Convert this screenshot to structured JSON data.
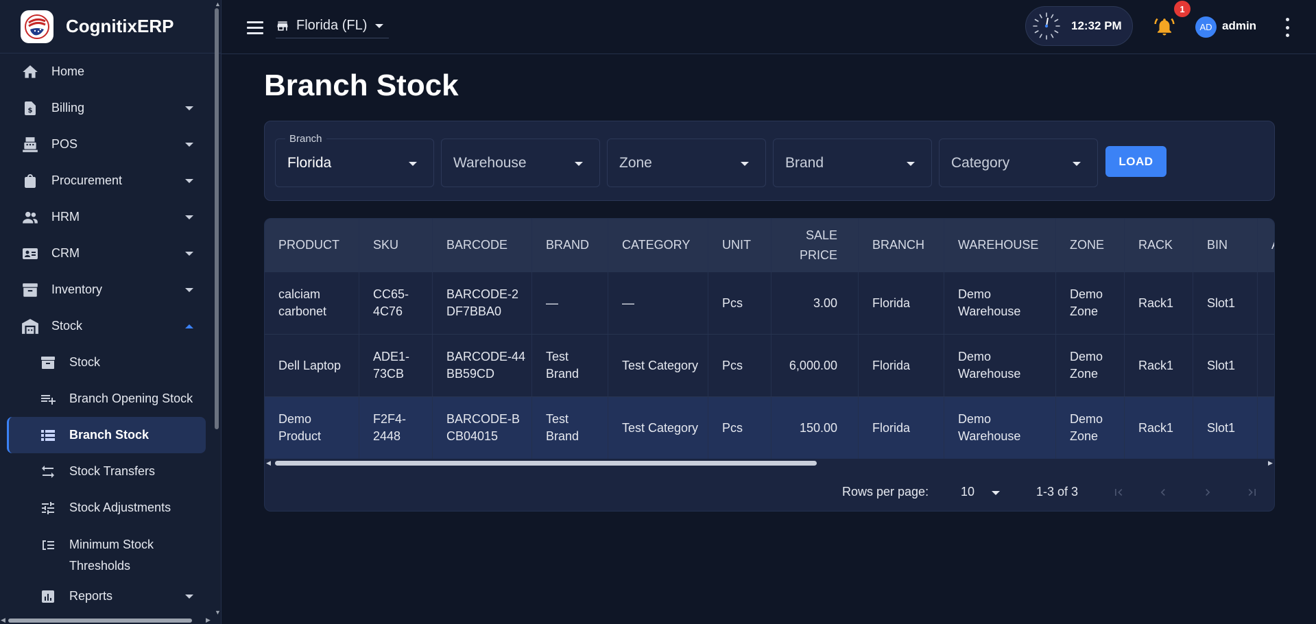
{
  "app": {
    "name": "CognitixERP"
  },
  "sidebar": {
    "items": [
      {
        "label": "Home",
        "icon": "home-icon"
      },
      {
        "label": "Billing",
        "icon": "billing-icon"
      },
      {
        "label": "POS",
        "icon": "pos-icon"
      },
      {
        "label": "Procurement",
        "icon": "bag-icon"
      },
      {
        "label": "HRM",
        "icon": "people-icon"
      },
      {
        "label": "CRM",
        "icon": "contact-card-icon"
      },
      {
        "label": "Inventory",
        "icon": "archive-icon"
      },
      {
        "label": "Stock",
        "icon": "warehouse-icon"
      },
      {
        "label": "Stock",
        "icon": "archive-icon"
      },
      {
        "label": "Branch Opening Stock",
        "icon": "playlist-add-icon"
      },
      {
        "label": "Branch Stock",
        "icon": "list-icon"
      },
      {
        "label": "Stock Transfers",
        "icon": "transfer-arrows-icon"
      },
      {
        "label": "Stock Adjustments",
        "icon": "tune-icon"
      },
      {
        "label": "Minimum Stock Thresholds",
        "icon": "threshold-icon"
      },
      {
        "label": "Reports",
        "icon": "chart-icon"
      }
    ]
  },
  "topbar": {
    "branch": "Florida (FL)",
    "time": "12:32 PM",
    "notifications": "1",
    "avatar": "AD",
    "user": "admin"
  },
  "page": {
    "title": "Branch Stock"
  },
  "filters": {
    "branch_label": "Branch",
    "branch_value": "Florida",
    "warehouse": "Warehouse",
    "zone": "Zone",
    "brand": "Brand",
    "category": "Category",
    "load": "LOAD"
  },
  "table": {
    "headers": [
      "PRODUCT",
      "SKU",
      "BARCODE",
      "BRAND",
      "CATEGORY",
      "UNIT",
      "SALE PRICE",
      "BRANCH",
      "WAREHOUSE",
      "ZONE",
      "RACK",
      "BIN",
      "A"
    ],
    "rows": [
      [
        "calciam carbonet",
        "CC65-4C76",
        "BARCODE-2DF7BBA0",
        "—",
        "—",
        "Pcs",
        "3.00",
        "Florida",
        "Demo Warehouse",
        "Demo Zone",
        "Rack1",
        "Slot1",
        ""
      ],
      [
        "Dell Laptop",
        "ADE1-73CB",
        "BARCODE-44BB59CD",
        "Test Brand",
        "Test Category",
        "Pcs",
        "6,000.00",
        "Florida",
        "Demo Warehouse",
        "Demo Zone",
        "Rack1",
        "Slot1",
        ""
      ],
      [
        "Demo Product",
        "F2F4-2448",
        "BARCODE-BCB04015",
        "Test Brand",
        "Test Category",
        "Pcs",
        "150.00",
        "Florida",
        "Demo Warehouse",
        "Demo Zone",
        "Rack1",
        "Slot1",
        ""
      ]
    ]
  },
  "pagination": {
    "rows_per_page_label": "Rows per page:",
    "rows_per_page": "10",
    "range": "1-3 of 3"
  },
  "colors": {
    "accent": "#3b82f6",
    "background": "#0f1626",
    "sidebar": "#161f33",
    "badge": "#e53935",
    "bell": "#f5a623"
  }
}
